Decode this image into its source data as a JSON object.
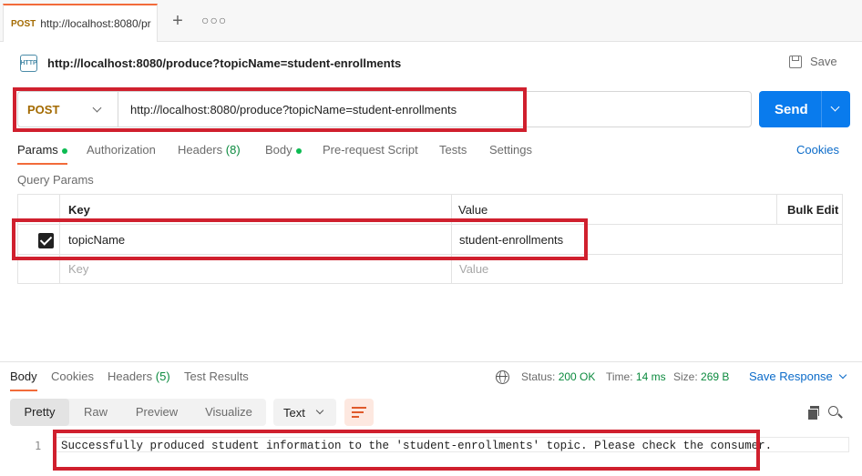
{
  "tab": {
    "method": "POST",
    "url_truncated": "http://localhost:8080/pr"
  },
  "request": {
    "title": "http://localhost:8080/produce?topicName=student-enrollments",
    "save_label": "Save",
    "method": "POST",
    "url": "http://localhost:8080/produce?topicName=student-enrollments",
    "send_label": "Send"
  },
  "request_tabs": {
    "params": "Params",
    "authorization": "Authorization",
    "headers": "Headers",
    "headers_count": "(8)",
    "body": "Body",
    "prerequest": "Pre-request Script",
    "tests": "Tests",
    "settings": "Settings",
    "cookies": "Cookies"
  },
  "query_params": {
    "title": "Query Params",
    "headers": {
      "key": "Key",
      "value": "Value",
      "bulk_edit": "Bulk Edit"
    },
    "rows": [
      {
        "key": "topicName",
        "value": "student-enrollments",
        "checked": true
      }
    ],
    "placeholder": {
      "key": "Key",
      "value": "Value"
    }
  },
  "response": {
    "tabs": {
      "body": "Body",
      "cookies": "Cookies",
      "headers": "Headers",
      "headers_count": "(5)",
      "test_results": "Test Results"
    },
    "status_label": "Status:",
    "status_value": "200 OK",
    "time_label": "Time:",
    "time_value": "14 ms",
    "size_label": "Size:",
    "size_value": "269 B",
    "save_response": "Save Response",
    "views": {
      "pretty": "Pretty",
      "raw": "Raw",
      "preview": "Preview",
      "visualize": "Visualize"
    },
    "format": "Text",
    "line_number": "1",
    "body_line": "Successfully produced student information to the 'student-enrollments' topic. Please check the consumer."
  },
  "colors": {
    "accent": "#f26b3a",
    "send": "#097bed",
    "method": "#a36a00",
    "status_ok": "#0b8a3e",
    "annotation": "#d0202e"
  }
}
